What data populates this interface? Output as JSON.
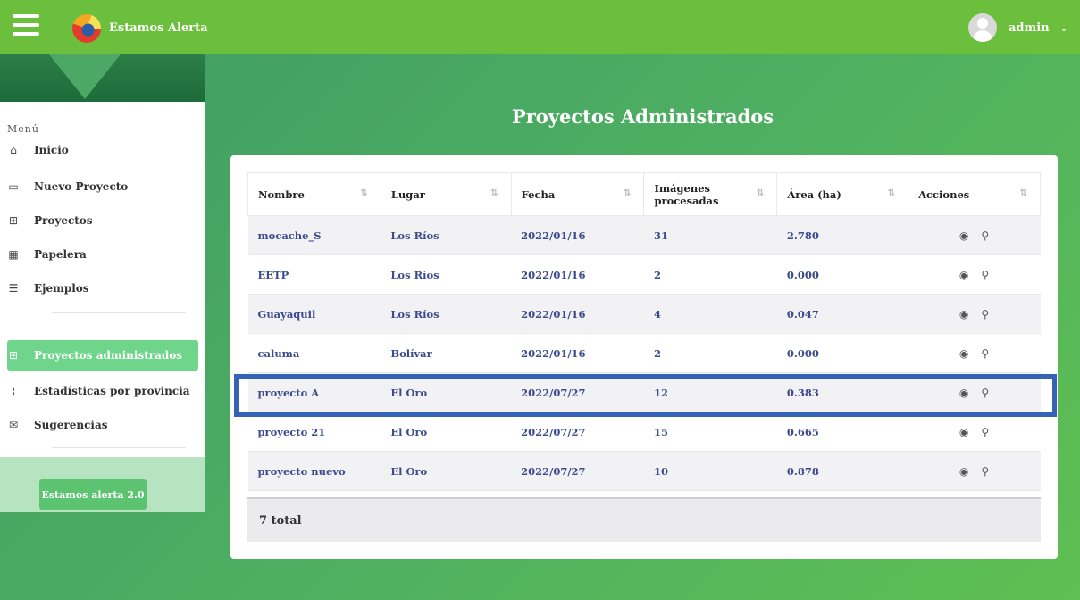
{
  "header": {
    "app_title": "Estamos Alerta",
    "user_name": "admin"
  },
  "sidebar": {
    "menu_label": "Menú",
    "items": [
      {
        "label": "Inicio",
        "icon": "home-icon"
      },
      {
        "label": "Nuevo Proyecto",
        "icon": "new-project-icon"
      },
      {
        "label": "Proyectos",
        "icon": "grid-icon"
      },
      {
        "label": "Papelera",
        "icon": "trash-grid-icon"
      },
      {
        "label": "Ejemplos",
        "icon": "list-icon"
      }
    ],
    "admin_items": [
      {
        "label": "Proyectos administrados",
        "icon": "grid-icon",
        "active": true
      },
      {
        "label": "Estadísticas por provincia",
        "icon": "chart-line-icon"
      },
      {
        "label": "Sugerencias",
        "icon": "mail-icon"
      }
    ],
    "footer_button": "Estamos alerta 2.0"
  },
  "main": {
    "title": "Proyectos Administrados",
    "columns": [
      "Nombre",
      "Lugar",
      "Fecha",
      "Imágenes procesadas",
      "Área (ha)",
      "Acciones"
    ],
    "rows": [
      {
        "nombre": "mocache_S",
        "lugar": "Los Ríos",
        "fecha": "2022/01/16",
        "imagenes": "31",
        "area": "2.780"
      },
      {
        "nombre": "EETP",
        "lugar": "Los Ríos",
        "fecha": "2022/01/16",
        "imagenes": "2",
        "area": "0.000"
      },
      {
        "nombre": "Guayaquil",
        "lugar": "Los Ríos",
        "fecha": "2022/01/16",
        "imagenes": "4",
        "area": "0.047"
      },
      {
        "nombre": "caluma",
        "lugar": "Bolívar",
        "fecha": "2022/01/16",
        "imagenes": "2",
        "area": "0.000"
      },
      {
        "nombre": "proyecto A",
        "lugar": "El Oro",
        "fecha": "2022/07/27",
        "imagenes": "12",
        "area": "0.383"
      },
      {
        "nombre": "proyecto 21",
        "lugar": "El Oro",
        "fecha": "2022/07/27",
        "imagenes": "15",
        "area": "0.665"
      },
      {
        "nombre": "proyecto nuevo",
        "lugar": "El Oro",
        "fecha": "2022/07/27",
        "imagenes": "10",
        "area": "0.878"
      }
    ],
    "total": "7 total",
    "highlighted_row": "proyecto A"
  },
  "colors": {
    "topbar": "#6cbf3c",
    "active_nav": "#6ed58a",
    "highlight_border": "#3563b5",
    "cell_text": "#3c4b8c"
  }
}
